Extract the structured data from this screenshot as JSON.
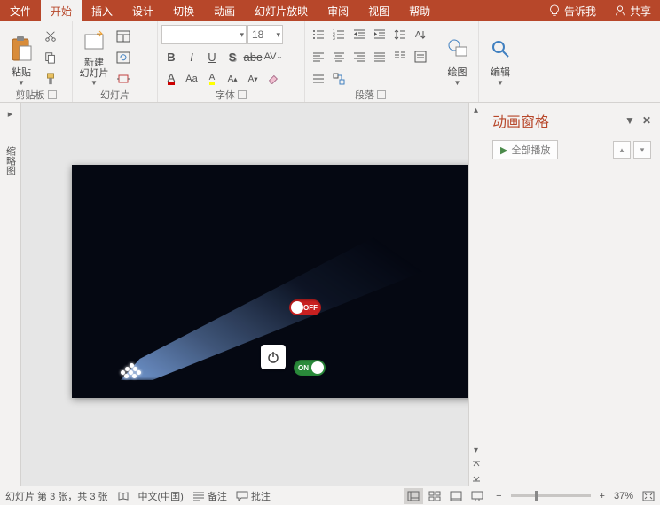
{
  "menu": {
    "tabs": [
      "文件",
      "开始",
      "插入",
      "设计",
      "切换",
      "动画",
      "幻灯片放映",
      "审阅",
      "视图",
      "帮助"
    ],
    "active_index": 1,
    "tellme": "告诉我",
    "share": "共享"
  },
  "ribbon": {
    "clipboard": {
      "label": "剪贴板",
      "paste": "粘贴"
    },
    "slides": {
      "label": "幻灯片",
      "new_slide": "新建\n幻灯片"
    },
    "font": {
      "label": "字体",
      "name_placeholder": "",
      "size": "18"
    },
    "paragraph": {
      "label": "段落"
    },
    "drawing": {
      "label": "绘图",
      "btn": "绘图"
    },
    "editing": {
      "label": "编辑",
      "btn": "编辑"
    }
  },
  "collapsed_panel": {
    "label": "缩略图"
  },
  "slide": {
    "off": "OFF",
    "on": "ON"
  },
  "pane": {
    "title": "动画窗格",
    "play_all": "全部播放"
  },
  "status": {
    "slide_info": "幻灯片 第 3 张，共 3 张",
    "lang": "中文(中国)",
    "notes": "备注",
    "comments": "批注",
    "zoom": "37%"
  }
}
